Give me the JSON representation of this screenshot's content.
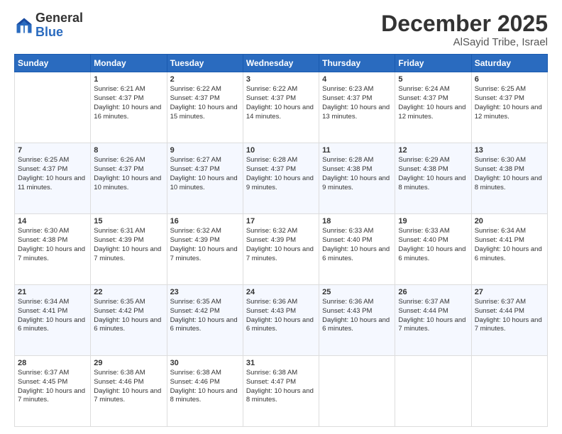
{
  "logo": {
    "general": "General",
    "blue": "Blue"
  },
  "header": {
    "title": "December 2025",
    "subtitle": "AlSayid Tribe, Israel"
  },
  "weekdays": [
    "Sunday",
    "Monday",
    "Tuesday",
    "Wednesday",
    "Thursday",
    "Friday",
    "Saturday"
  ],
  "weeks": [
    [
      {
        "day": "",
        "sunrise": "",
        "sunset": "",
        "daylight": ""
      },
      {
        "day": "1",
        "sunrise": "Sunrise: 6:21 AM",
        "sunset": "Sunset: 4:37 PM",
        "daylight": "Daylight: 10 hours and 16 minutes."
      },
      {
        "day": "2",
        "sunrise": "Sunrise: 6:22 AM",
        "sunset": "Sunset: 4:37 PM",
        "daylight": "Daylight: 10 hours and 15 minutes."
      },
      {
        "day": "3",
        "sunrise": "Sunrise: 6:22 AM",
        "sunset": "Sunset: 4:37 PM",
        "daylight": "Daylight: 10 hours and 14 minutes."
      },
      {
        "day": "4",
        "sunrise": "Sunrise: 6:23 AM",
        "sunset": "Sunset: 4:37 PM",
        "daylight": "Daylight: 10 hours and 13 minutes."
      },
      {
        "day": "5",
        "sunrise": "Sunrise: 6:24 AM",
        "sunset": "Sunset: 4:37 PM",
        "daylight": "Daylight: 10 hours and 12 minutes."
      },
      {
        "day": "6",
        "sunrise": "Sunrise: 6:25 AM",
        "sunset": "Sunset: 4:37 PM",
        "daylight": "Daylight: 10 hours and 12 minutes."
      }
    ],
    [
      {
        "day": "7",
        "sunrise": "Sunrise: 6:25 AM",
        "sunset": "Sunset: 4:37 PM",
        "daylight": "Daylight: 10 hours and 11 minutes."
      },
      {
        "day": "8",
        "sunrise": "Sunrise: 6:26 AM",
        "sunset": "Sunset: 4:37 PM",
        "daylight": "Daylight: 10 hours and 10 minutes."
      },
      {
        "day": "9",
        "sunrise": "Sunrise: 6:27 AM",
        "sunset": "Sunset: 4:37 PM",
        "daylight": "Daylight: 10 hours and 10 minutes."
      },
      {
        "day": "10",
        "sunrise": "Sunrise: 6:28 AM",
        "sunset": "Sunset: 4:37 PM",
        "daylight": "Daylight: 10 hours and 9 minutes."
      },
      {
        "day": "11",
        "sunrise": "Sunrise: 6:28 AM",
        "sunset": "Sunset: 4:38 PM",
        "daylight": "Daylight: 10 hours and 9 minutes."
      },
      {
        "day": "12",
        "sunrise": "Sunrise: 6:29 AM",
        "sunset": "Sunset: 4:38 PM",
        "daylight": "Daylight: 10 hours and 8 minutes."
      },
      {
        "day": "13",
        "sunrise": "Sunrise: 6:30 AM",
        "sunset": "Sunset: 4:38 PM",
        "daylight": "Daylight: 10 hours and 8 minutes."
      }
    ],
    [
      {
        "day": "14",
        "sunrise": "Sunrise: 6:30 AM",
        "sunset": "Sunset: 4:38 PM",
        "daylight": "Daylight: 10 hours and 7 minutes."
      },
      {
        "day": "15",
        "sunrise": "Sunrise: 6:31 AM",
        "sunset": "Sunset: 4:39 PM",
        "daylight": "Daylight: 10 hours and 7 minutes."
      },
      {
        "day": "16",
        "sunrise": "Sunrise: 6:32 AM",
        "sunset": "Sunset: 4:39 PM",
        "daylight": "Daylight: 10 hours and 7 minutes."
      },
      {
        "day": "17",
        "sunrise": "Sunrise: 6:32 AM",
        "sunset": "Sunset: 4:39 PM",
        "daylight": "Daylight: 10 hours and 7 minutes."
      },
      {
        "day": "18",
        "sunrise": "Sunrise: 6:33 AM",
        "sunset": "Sunset: 4:40 PM",
        "daylight": "Daylight: 10 hours and 6 minutes."
      },
      {
        "day": "19",
        "sunrise": "Sunrise: 6:33 AM",
        "sunset": "Sunset: 4:40 PM",
        "daylight": "Daylight: 10 hours and 6 minutes."
      },
      {
        "day": "20",
        "sunrise": "Sunrise: 6:34 AM",
        "sunset": "Sunset: 4:41 PM",
        "daylight": "Daylight: 10 hours and 6 minutes."
      }
    ],
    [
      {
        "day": "21",
        "sunrise": "Sunrise: 6:34 AM",
        "sunset": "Sunset: 4:41 PM",
        "daylight": "Daylight: 10 hours and 6 minutes."
      },
      {
        "day": "22",
        "sunrise": "Sunrise: 6:35 AM",
        "sunset": "Sunset: 4:42 PM",
        "daylight": "Daylight: 10 hours and 6 minutes."
      },
      {
        "day": "23",
        "sunrise": "Sunrise: 6:35 AM",
        "sunset": "Sunset: 4:42 PM",
        "daylight": "Daylight: 10 hours and 6 minutes."
      },
      {
        "day": "24",
        "sunrise": "Sunrise: 6:36 AM",
        "sunset": "Sunset: 4:43 PM",
        "daylight": "Daylight: 10 hours and 6 minutes."
      },
      {
        "day": "25",
        "sunrise": "Sunrise: 6:36 AM",
        "sunset": "Sunset: 4:43 PM",
        "daylight": "Daylight: 10 hours and 6 minutes."
      },
      {
        "day": "26",
        "sunrise": "Sunrise: 6:37 AM",
        "sunset": "Sunset: 4:44 PM",
        "daylight": "Daylight: 10 hours and 7 minutes."
      },
      {
        "day": "27",
        "sunrise": "Sunrise: 6:37 AM",
        "sunset": "Sunset: 4:44 PM",
        "daylight": "Daylight: 10 hours and 7 minutes."
      }
    ],
    [
      {
        "day": "28",
        "sunrise": "Sunrise: 6:37 AM",
        "sunset": "Sunset: 4:45 PM",
        "daylight": "Daylight: 10 hours and 7 minutes."
      },
      {
        "day": "29",
        "sunrise": "Sunrise: 6:38 AM",
        "sunset": "Sunset: 4:46 PM",
        "daylight": "Daylight: 10 hours and 7 minutes."
      },
      {
        "day": "30",
        "sunrise": "Sunrise: 6:38 AM",
        "sunset": "Sunset: 4:46 PM",
        "daylight": "Daylight: 10 hours and 8 minutes."
      },
      {
        "day": "31",
        "sunrise": "Sunrise: 6:38 AM",
        "sunset": "Sunset: 4:47 PM",
        "daylight": "Daylight: 10 hours and 8 minutes."
      },
      {
        "day": "",
        "sunrise": "",
        "sunset": "",
        "daylight": ""
      },
      {
        "day": "",
        "sunrise": "",
        "sunset": "",
        "daylight": ""
      },
      {
        "day": "",
        "sunrise": "",
        "sunset": "",
        "daylight": ""
      }
    ]
  ]
}
